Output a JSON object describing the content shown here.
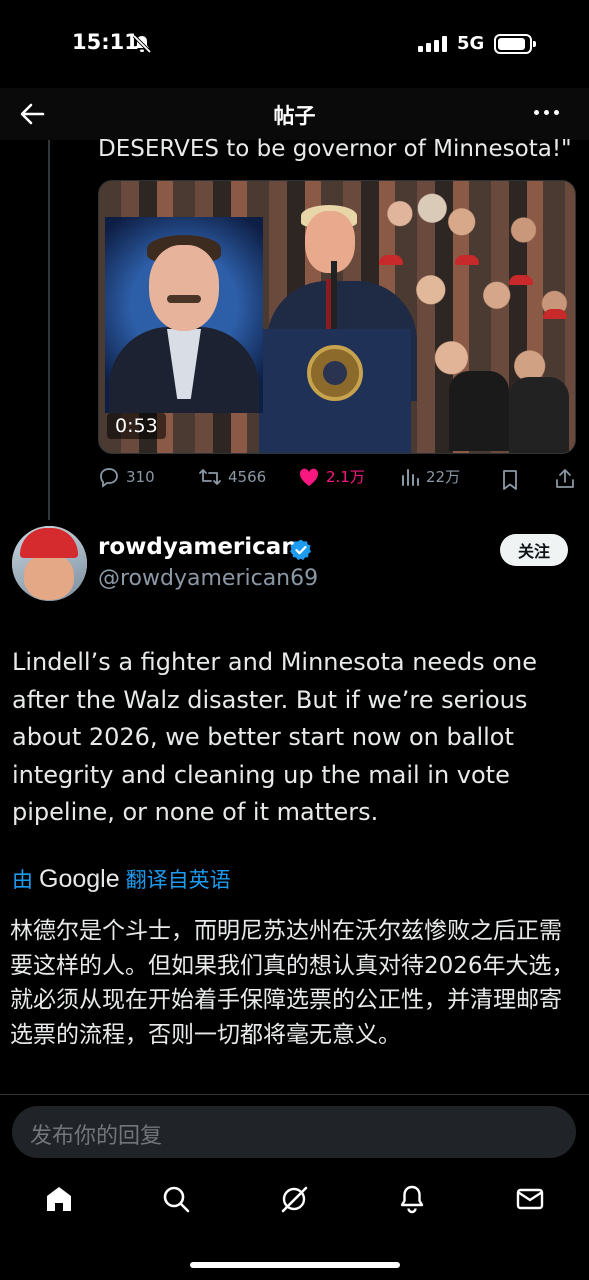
{
  "status_bar": {
    "time": "15:11",
    "network": "5G",
    "battery_level": 0.9
  },
  "nav": {
    "title": "帖子"
  },
  "previous_post": {
    "text_tail": "DESERVES to be governor of Minnesota!\"",
    "video_duration": "0:53",
    "stats": {
      "replies": "310",
      "reposts": "4566",
      "likes": "2.1万",
      "views": "22万"
    }
  },
  "reply": {
    "display_name": "rowdyamerican",
    "handle": "@rowdyamerican69",
    "verified": true,
    "follow_label": "关注",
    "text": "Lindell’s a fighter and Minnesota needs one after the Walz disaster. But if we’re serious about 2026, we better start now on ballot integrity and cleaning up the mail in vote pipeline, or none of it matters.",
    "translate_prefix": "由",
    "translate_brand": "Google",
    "translate_suffix": "翻译自英语",
    "translated_text": "林德尔是个斗士，而明尼苏达州在沃尔兹惨败之后正需要这样的人。但如果我们真的想认真对待2026年大选，就必须从现在开始着手保障选票的公正性，并清理邮寄选票的流程，否则一切都将毫无意义。"
  },
  "composer": {
    "placeholder": "发布你的回复"
  },
  "tabs": [
    {
      "icon": "home-icon"
    },
    {
      "icon": "search-icon"
    },
    {
      "icon": "grok-icon"
    },
    {
      "icon": "notifications-icon"
    },
    {
      "icon": "messages-icon"
    }
  ],
  "colors": {
    "accent": "#1d9bf0",
    "like": "#f91880",
    "muted": "#8b98a5",
    "background": "#000000"
  }
}
